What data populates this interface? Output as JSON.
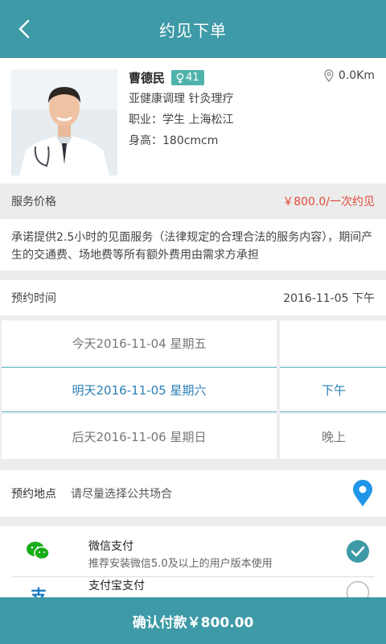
{
  "header": {
    "title": "约见下单"
  },
  "profile": {
    "name": "曹德民",
    "age": "41",
    "distance": "0.0Km",
    "tags": "亚健康调理 针灸理疗",
    "job": "职业：学生  上海松江",
    "height": "身高：180cmcm"
  },
  "price": {
    "label": "服务价格",
    "value": "￥800.0/一次约见"
  },
  "promise": "承诺提供2.5小时的见面服务（法律规定的合理合法的服务内容），期间产生的交通费、场地费等所有额外费用由需求方承担",
  "time": {
    "label": "预约时间",
    "value": "2016-11-05  下午",
    "days": [
      "今天2016-11-04 星期五",
      "明天2016-11-05 星期六",
      "后天2016-11-06 星期日"
    ],
    "periods": [
      "",
      "下午",
      "晚上"
    ]
  },
  "location": {
    "label": "预约地点",
    "hint": "请尽量选择公共场合"
  },
  "payment": {
    "items": [
      {
        "title": "微信支付",
        "sub": "推荐安装微信5.0及以上的用户版本使用",
        "checked": true
      },
      {
        "title": "支付宝支付",
        "sub": "",
        "checked": false
      }
    ]
  },
  "confirm": {
    "label": "确认付款￥800.00"
  },
  "colors": {
    "primary": "#3d9aa6",
    "price": "#e04a3a",
    "selected": "#2a7fb5",
    "wechat": "#1aad19",
    "alipay": "#1678c2"
  }
}
